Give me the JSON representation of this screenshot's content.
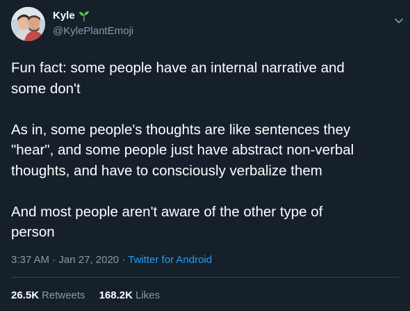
{
  "author": {
    "display_name": "Kyle",
    "emoji": "seedling-emoji",
    "handle": "@KylePlantEmoji"
  },
  "tweet": {
    "paragraphs": [
      "Fun fact: some people have an internal narrative and\nsome don't",
      "As in, some people's thoughts are like sentences they\n\"hear\", and some people just have abstract non-verbal\nthoughts, and have to consciously verbalize them",
      "And most people aren't aware of the other type of\nperson"
    ],
    "time": "3:37 AM",
    "date": "Jan 27, 2020",
    "source": "Twitter for Android"
  },
  "stats": {
    "retweets_count": "26.5K",
    "retweets_label": "Retweets",
    "likes_count": "168.2K",
    "likes_label": "Likes"
  },
  "colors": {
    "background": "#15202b",
    "text": "#ffffff",
    "secondary": "#8899a6",
    "link": "#1da1f2",
    "divider": "#38444d"
  }
}
